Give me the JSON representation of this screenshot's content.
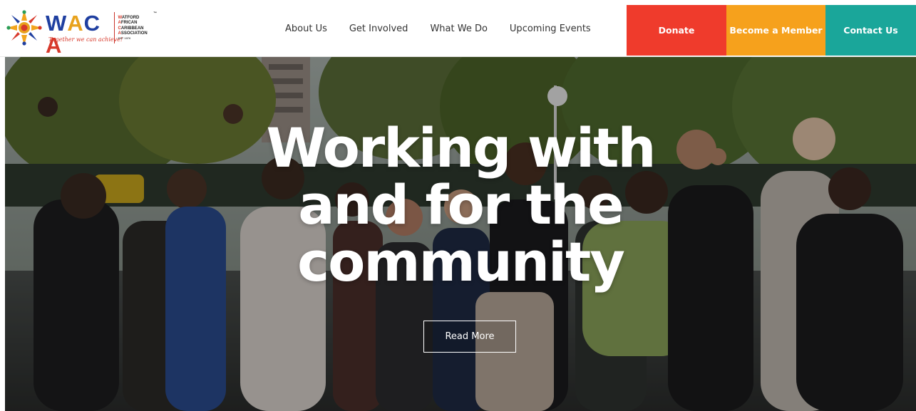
{
  "header": {
    "logo": {
      "wordmark": "WACA",
      "tagline": "Together we can achieve!",
      "association_lines": [
        "Watford",
        "African",
        "Caribbean",
        "Association"
      ],
      "est": "EST 1976",
      "trademark": "™"
    },
    "nav": [
      {
        "label": "About Us"
      },
      {
        "label": "Get Involved"
      },
      {
        "label": "What We Do"
      },
      {
        "label": "Upcoming Events"
      }
    ],
    "cta": {
      "donate": {
        "label": "Donate",
        "color": "#ef3b2c"
      },
      "member": {
        "label": "Become a Member",
        "color": "#f6a11c"
      },
      "contact": {
        "label": "Contact Us",
        "color": "#1aa69a"
      }
    }
  },
  "hero": {
    "title_lines": [
      "Working with",
      "and for the",
      "community"
    ],
    "button_label": "Read More",
    "background": "group photo"
  }
}
